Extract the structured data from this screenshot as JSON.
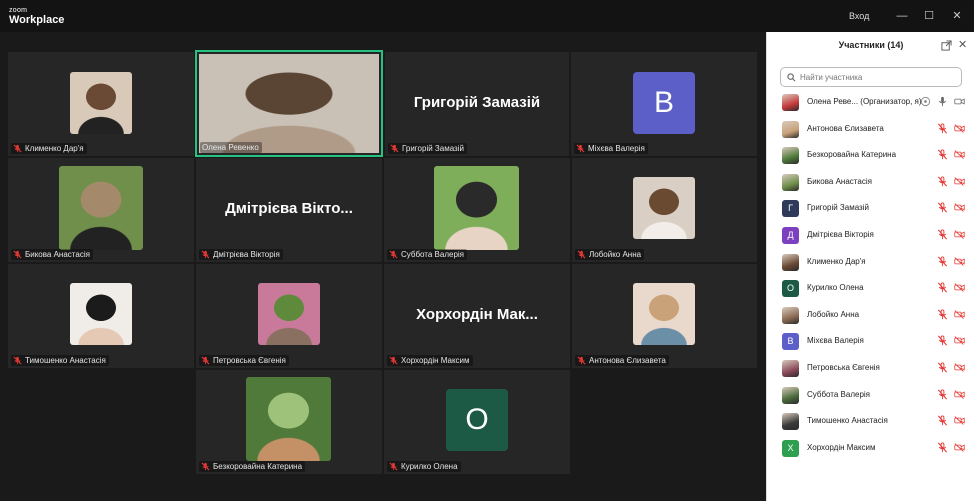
{
  "titlebar": {
    "logo_line1": "zoom",
    "logo_line2": "Workplace",
    "signin_label": "Вход",
    "minimize_glyph": "—",
    "maximize_glyph": "☐",
    "close_glyph": "✕"
  },
  "tiles": [
    {
      "name": "Клименко Дар'я",
      "kind": "photo",
      "palette": [
        "#d8c9b8",
        "#6b4a35",
        "#222"
      ]
    },
    {
      "name": "Олена Ревенко",
      "kind": "video",
      "palette": [
        "#c9c1b5",
        "#5a4535",
        "#b09a88"
      ]
    },
    {
      "name": "Григорій Замазій",
      "kind": "bigname",
      "display": "Григорій Замазій"
    },
    {
      "name": "Міхєва Валерія",
      "kind": "avatar",
      "letter": "B",
      "color": "#5b5fc7"
    },
    {
      "name": "Бикова Анастасія",
      "kind": "photo",
      "palette": [
        "#6f8f4a",
        "#a48a6a",
        "#222"
      ]
    },
    {
      "name": "Дмітрієва Вікторія",
      "kind": "bigname",
      "display": "Дмітрієва Вікто..."
    },
    {
      "name": "Суббота Валерія",
      "kind": "photo",
      "palette": [
        "#7fae5a",
        "#2a2a2a",
        "#e8d4c4"
      ]
    },
    {
      "name": "Лобойко Анна",
      "kind": "photo",
      "palette": [
        "#d9cfc4",
        "#6b4a32",
        "#f2ede8"
      ]
    },
    {
      "name": "Тимошенко Анастасія",
      "kind": "photo",
      "palette": [
        "#f0ece8",
        "#1b1b1b",
        "#e6c9b5"
      ]
    },
    {
      "name": "Петровська Євгенія",
      "kind": "photo",
      "palette": [
        "#c97a9a",
        "#5f8a3c",
        "#8a7060"
      ]
    },
    {
      "name": "Хорхордін Максим",
      "kind": "bigname",
      "display": "Хорхордін Мак..."
    },
    {
      "name": "Антонова Єлизавета",
      "kind": "photo",
      "palette": [
        "#e9d9cc",
        "#c9a27a",
        "#6c8fa8"
      ]
    },
    {
      "name": "Безкоровайна Катерина",
      "kind": "photo",
      "palette": [
        "#4f7a3a",
        "#9fc27a",
        "#c49066"
      ]
    },
    {
      "name": "Курилко Олена",
      "kind": "avatar",
      "letter": "O",
      "color": "#1c5a45"
    }
  ],
  "panel": {
    "title": "Участники (14)",
    "search_placeholder": "Найти участника",
    "close_glyph": "✕",
    "participants": [
      {
        "name": "Олена Реве... (Организатор, я)",
        "avatar": "photo",
        "color": "#c63a3a",
        "self": true
      },
      {
        "name": "Антонова Єлизавета",
        "avatar": "photo",
        "color": "#c9a27a"
      },
      {
        "name": "Безкоровайна Катерина",
        "avatar": "photo",
        "color": "#4f7a3a"
      },
      {
        "name": "Бикова Анастасія",
        "avatar": "photo",
        "color": "#6f8f4a"
      },
      {
        "name": "Григорій Замазій",
        "avatar": "letter",
        "letter": "Г",
        "color": "#2d3a5a"
      },
      {
        "name": "Дмітрієва Вікторія",
        "avatar": "letter",
        "letter": "Д",
        "color": "#7b3fbf"
      },
      {
        "name": "Клименко Дар'я",
        "avatar": "photo",
        "color": "#6b4a35"
      },
      {
        "name": "Курилко Олена",
        "avatar": "letter",
        "letter": "О",
        "color": "#1c5a45"
      },
      {
        "name": "Лобойко Анна",
        "avatar": "photo",
        "color": "#8a6a52"
      },
      {
        "name": "Міхєва Валерія",
        "avatar": "letter",
        "letter": "В",
        "color": "#5b5fc7"
      },
      {
        "name": "Петровська Євгенія",
        "avatar": "photo",
        "color": "#8a4a5a"
      },
      {
        "name": "Суббота Валерія",
        "avatar": "photo",
        "color": "#4a6a3a"
      },
      {
        "name": "Тимошенко Анастасія",
        "avatar": "photo",
        "color": "#3a3a3a"
      },
      {
        "name": "Хорхордін Максим",
        "avatar": "letter",
        "letter": "Х",
        "color": "#2e9e4f"
      }
    ]
  },
  "colors": {
    "active_speaker": "#26c281",
    "muted_red": "#e53935",
    "tile_bg": "#262626",
    "stage_bg": "#1a1a1a"
  }
}
